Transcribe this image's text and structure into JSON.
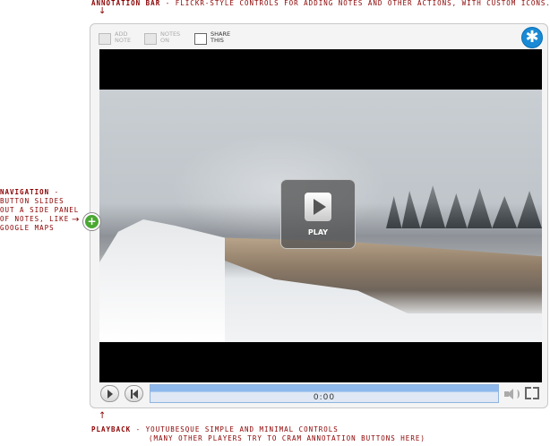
{
  "annotations": {
    "top": {
      "title": "Annotation bar",
      "text": "- flickr-style controls for adding notes and other actions, with custom icons."
    },
    "left": {
      "title": "Navigation",
      "text": "- button slides out a side panel of notes, like google maps"
    },
    "bottom": {
      "title": "Playback",
      "text": "- YouTubesque simple and minimal controls",
      "text2": "(many other players try to cram annotation buttons here)"
    }
  },
  "toolbar": {
    "add_note": {
      "line1": "Add",
      "line2": "Note"
    },
    "notes_on": {
      "line1": "Notes",
      "line2": "On"
    },
    "share": {
      "line1": "Share",
      "line2": "This"
    },
    "logo_icon": "asterisk-logo-icon"
  },
  "video": {
    "play_label": "PLAY"
  },
  "controls": {
    "time": "0:00",
    "progress": 0
  },
  "colors": {
    "annotation": "#8b0000",
    "accent_blue": "#1a8ad6",
    "nav_green": "#4aa832",
    "progress_blue": "#8fb9ec"
  }
}
